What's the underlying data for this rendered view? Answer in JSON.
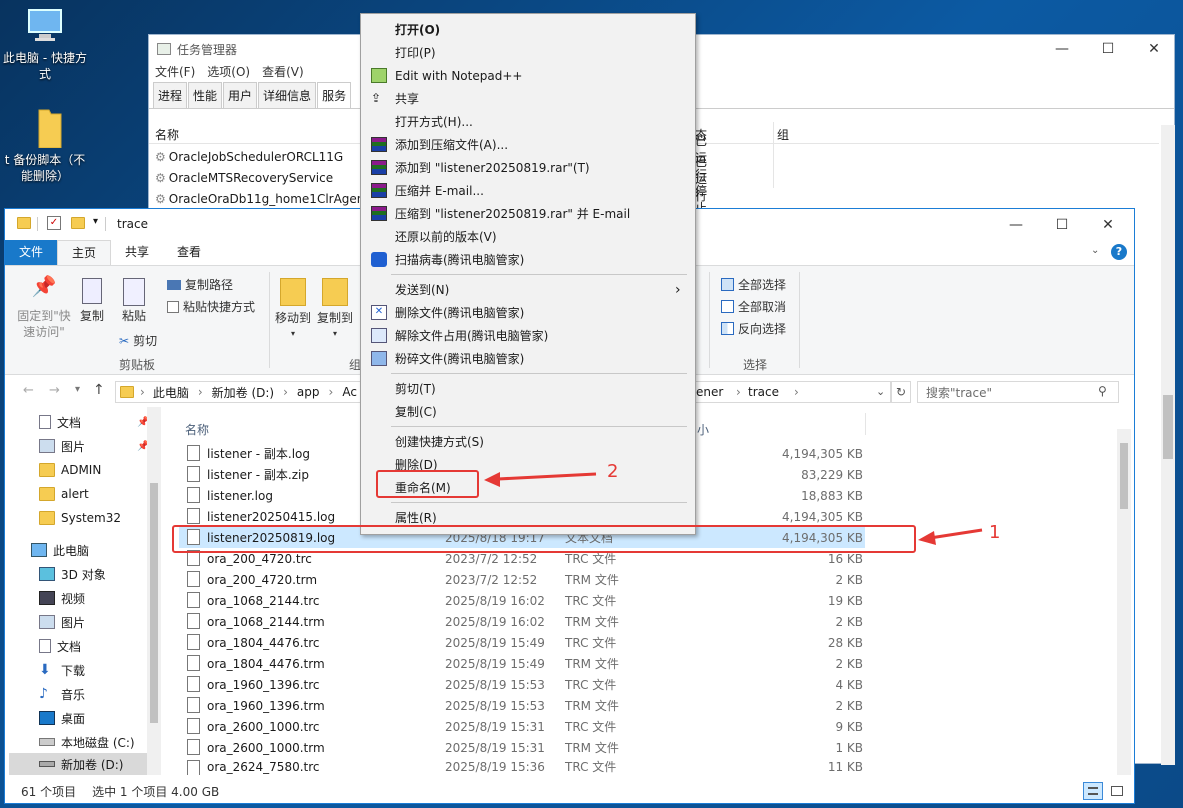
{
  "desktop": {
    "icons": [
      {
        "label": "此电脑 - 快捷方式"
      },
      {
        "label": "t  备份脚本（不能删除）"
      }
    ]
  },
  "taskmgr": {
    "title": "任务管理器",
    "menu": [
      "文件(F)",
      "选项(O)",
      "查看(V)"
    ],
    "tabs": [
      "进程",
      "性能",
      "用户",
      "详细信息",
      "服务"
    ],
    "col_name": "名称",
    "col_status_partial": "态",
    "col_group": "组",
    "rows": [
      {
        "name": "OracleJobSchedulerORCL11G",
        "status": "已运行"
      },
      {
        "name": "OracleMTSRecoveryService",
        "status": "已运行"
      },
      {
        "name": "OracleOraDb11g_home1ClrAgen",
        "status": "停止"
      }
    ]
  },
  "explorer": {
    "title": "trace",
    "ribbon_tabs": [
      "文件",
      "主页",
      "共享",
      "查看"
    ],
    "ribbon": {
      "pin": "固定到\"快速访问\"",
      "copy": "复制",
      "paste": "粘贴",
      "copy_path": "复制路径",
      "paste_shortcut": "粘贴快捷方式",
      "cut": "剪切",
      "clipboard_group": "剪贴板",
      "move_to": "移动到",
      "copy_to": "复制到",
      "org_group_partial": "组",
      "select_all": "全部选择",
      "select_none": "全部取消",
      "invert": "反向选择",
      "select_group": "选择"
    },
    "address": {
      "segments": [
        "此电脑",
        "新加卷 (D:)",
        "app",
        "Ac"
      ],
      "tail_segments": [
        "ener",
        "trace"
      ]
    },
    "search_placeholder": "搜索\"trace\"",
    "nav": [
      {
        "label": "文档"
      },
      {
        "label": "图片"
      },
      {
        "label": "ADMIN"
      },
      {
        "label": "alert"
      },
      {
        "label": "System32"
      },
      {
        "label": "此电脑"
      },
      {
        "label": "3D 对象"
      },
      {
        "label": "视频"
      },
      {
        "label": "图片"
      },
      {
        "label": "文档"
      },
      {
        "label": "下载"
      },
      {
        "label": "音乐"
      },
      {
        "label": "桌面"
      },
      {
        "label": "本地磁盘 (C:)"
      },
      {
        "label": "新加卷 (D:)"
      }
    ],
    "col_name": "名称",
    "col_size_partial": "小",
    "files": [
      {
        "name": "listener - 副本.log",
        "date": "",
        "type": "",
        "size": "4,194,305 KB"
      },
      {
        "name": "listener - 副本.zip",
        "date": "",
        "type": "",
        "size": "83,229 KB"
      },
      {
        "name": "listener.log",
        "date": "",
        "type": "",
        "size": "18,883 KB"
      },
      {
        "name": "listener20250415.log",
        "date": "",
        "type": "",
        "size": "4,194,305 KB"
      },
      {
        "name": "listener20250819.log",
        "date": "2025/8/18 19:17",
        "type": "文本文档",
        "size": "4,194,305 KB"
      },
      {
        "name": "ora_200_4720.trc",
        "date": "2023/7/2 12:52",
        "type": "TRC 文件",
        "size": "16 KB"
      },
      {
        "name": "ora_200_4720.trm",
        "date": "2023/7/2 12:52",
        "type": "TRM 文件",
        "size": "2 KB"
      },
      {
        "name": "ora_1068_2144.trc",
        "date": "2025/8/19 16:02",
        "type": "TRC 文件",
        "size": "19 KB"
      },
      {
        "name": "ora_1068_2144.trm",
        "date": "2025/8/19 16:02",
        "type": "TRM 文件",
        "size": "2 KB"
      },
      {
        "name": "ora_1804_4476.trc",
        "date": "2025/8/19 15:49",
        "type": "TRC 文件",
        "size": "28 KB"
      },
      {
        "name": "ora_1804_4476.trm",
        "date": "2025/8/19 15:49",
        "type": "TRM 文件",
        "size": "2 KB"
      },
      {
        "name": "ora_1960_1396.trc",
        "date": "2025/8/19 15:53",
        "type": "TRC 文件",
        "size": "4 KB"
      },
      {
        "name": "ora_1960_1396.trm",
        "date": "2025/8/19 15:53",
        "type": "TRM 文件",
        "size": "2 KB"
      },
      {
        "name": "ora_2600_1000.trc",
        "date": "2025/8/19 15:31",
        "type": "TRC 文件",
        "size": "9 KB"
      },
      {
        "name": "ora_2600_1000.trm",
        "date": "2025/8/19 15:31",
        "type": "TRM 文件",
        "size": "1 KB"
      },
      {
        "name": "ora_2624_7580.trc",
        "date": "2025/8/19 15:36",
        "type": "TRC 文件",
        "size": "11 KB"
      }
    ],
    "status": {
      "count": "61 个项目",
      "selected": "选中 1 个项目  4.00 GB"
    }
  },
  "context_menu": {
    "items": [
      "打开(O)",
      "打印(P)",
      "Edit with Notepad++",
      "共享",
      "打开方式(H)...",
      "添加到压缩文件(A)...",
      "添加到 \"listener20250819.rar\"(T)",
      "压缩并 E-mail...",
      "压缩到 \"listener20250819.rar\" 并 E-mail",
      "还原以前的版本(V)",
      "扫描病毒(腾讯电脑管家)",
      "发送到(N)",
      "删除文件(腾讯电脑管家)",
      "解除文件占用(腾讯电脑管家)",
      "粉碎文件(腾讯电脑管家)",
      "剪切(T)",
      "复制(C)",
      "创建快捷方式(S)",
      "删除(D)",
      "重命名(M)",
      "属性(R)"
    ]
  },
  "annotations": {
    "one": "1",
    "two": "2"
  },
  "colors": {
    "accent": "#1979ca",
    "annotation": "#e53935",
    "selection": "#cce8ff"
  }
}
